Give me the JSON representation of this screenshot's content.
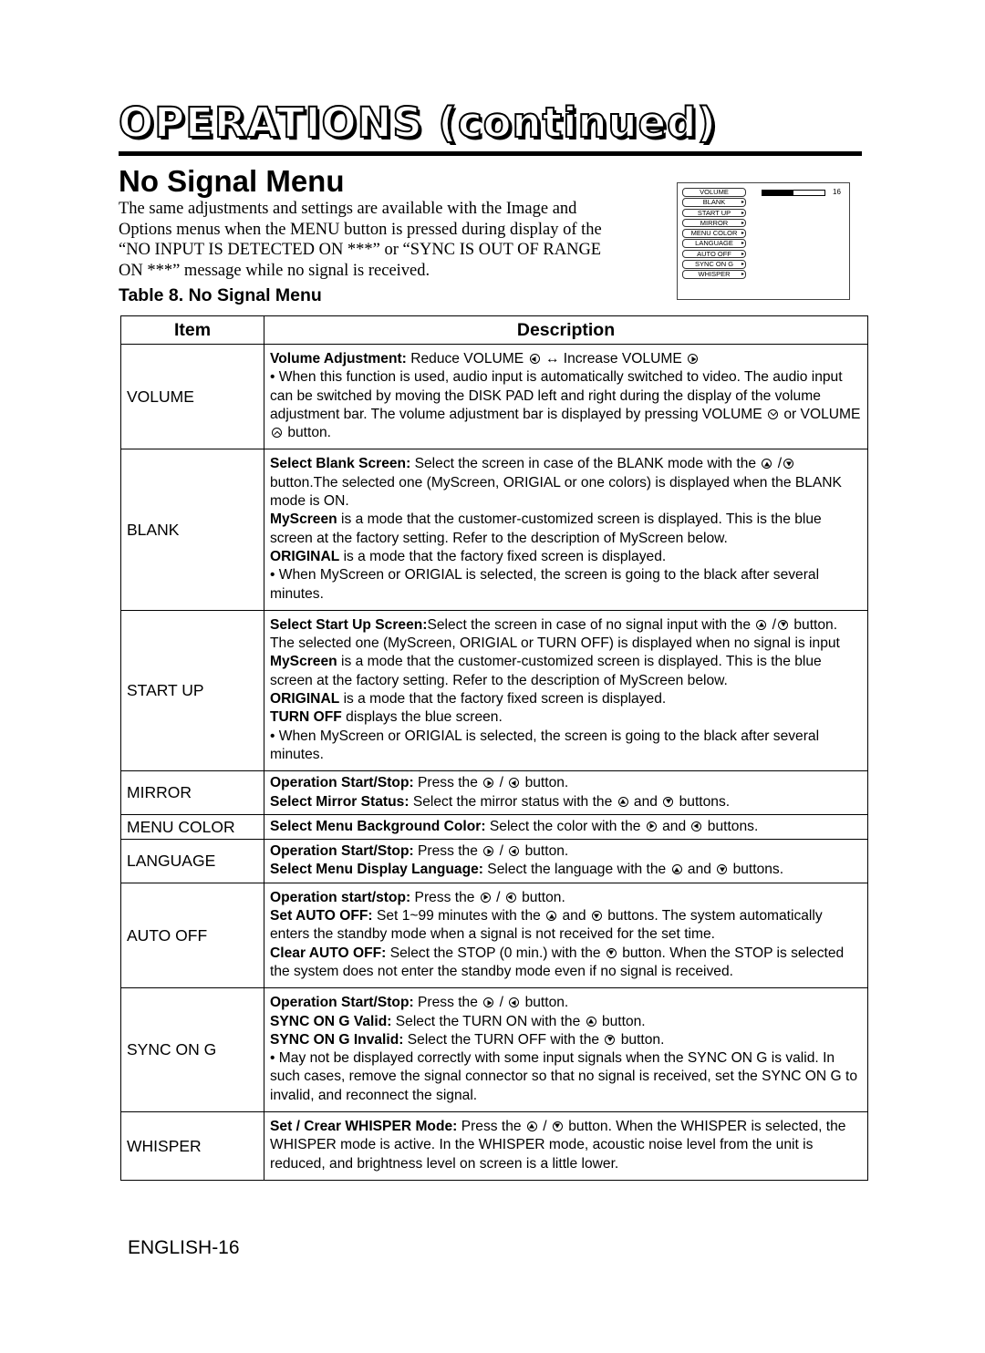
{
  "header": {
    "title": "OPERATIONS (continued)",
    "section_heading": "No Signal Menu"
  },
  "intro": {
    "lines": [
      "The same adjustments and settings are available with the Image and",
      "Options menus when the MENU button is pressed during display of the",
      "“NO INPUT IS DETECTED ON ***” or “SYNC IS OUT OF RANGE",
      "ON ***” message while no signal is received."
    ]
  },
  "menu_preview": {
    "items": [
      {
        "label": "VOLUME",
        "has_arrow": false
      },
      {
        "label": "BLANK",
        "has_arrow": true
      },
      {
        "label": "START UP",
        "has_arrow": true
      },
      {
        "label": "MIRROR",
        "has_arrow": true
      },
      {
        "label": "MENU COLOR",
        "has_arrow": true
      },
      {
        "label": "LANGUAGE",
        "has_arrow": true
      },
      {
        "label": "AUTO OFF",
        "has_arrow": true
      },
      {
        "label": "SYNC ON G",
        "has_arrow": true
      },
      {
        "label": "WHISPER",
        "has_arrow": true
      }
    ],
    "arrow_glyph": "▸",
    "volume_value": "16",
    "volume_fill_fraction": 0.5
  },
  "table": {
    "caption": "Table 8. No Signal Menu",
    "headers": {
      "item": "Item",
      "description": "Description"
    },
    "rows": [
      {
        "item": "VOLUME",
        "lines": [
          [
            {
              "b": "Volume Adjustment:"
            },
            {
              "t": " Reduce VOLUME "
            },
            {
              "icon": "left"
            },
            {
              "t": " ↔ Increase VOLUME "
            },
            {
              "icon": "right"
            }
          ],
          [
            {
              "t": "• When this function is used, audio input is automatically switched to video. The audio input can be switched by moving the DISK PAD left and right during the display of the volume adjustment bar. The volume adjustment bar is displayed by pressing VOLUME "
            },
            {
              "icon": "vdown"
            },
            {
              "t": " or VOLUME "
            },
            {
              "icon": "vup"
            },
            {
              "t": " button."
            }
          ]
        ]
      },
      {
        "item": "BLANK",
        "lines": [
          [
            {
              "b": "Select Blank Screen:"
            },
            {
              "t": " Select the screen in case of the BLANK mode with the "
            },
            {
              "icon": "up"
            },
            {
              "t": " /"
            },
            {
              "icon": "down"
            },
            {
              "t": " button.The selected one (MyScreen, ORIGIAL or one colors) is displayed when the BLANK mode is ON."
            }
          ],
          [
            {
              "b": "MyScreen"
            },
            {
              "t": " is a mode that the customer-customized screen is displayed. This is the blue screen at the factory setting. Refer to the description of MyScreen below."
            }
          ],
          [
            {
              "b": "ORIGINAL"
            },
            {
              "t": " is a mode that the factory fixed screen is displayed."
            }
          ],
          [
            {
              "t": "• When MyScreen or ORIGIAL is selected, the screen is going to the black after several minutes."
            }
          ]
        ]
      },
      {
        "item": "START UP",
        "lines": [
          [
            {
              "b": "Select Start Up Screen:"
            },
            {
              "t": "Select the screen in case of no signal input with the "
            },
            {
              "icon": "up"
            },
            {
              "t": " /"
            },
            {
              "icon": "down"
            },
            {
              "t": " button. The selected one (MyScreen, ORIGIAL or TURN OFF) is displayed when no signal is input"
            }
          ],
          [
            {
              "b": "MyScreen"
            },
            {
              "t": " is a mode that the customer-customized screen is displayed. This is the blue screen at the factory setting. Refer to the description of MyScreen below."
            }
          ],
          [
            {
              "b": "ORIGINAL"
            },
            {
              "t": " is a mode that the factory fixed screen is displayed."
            }
          ],
          [
            {
              "b": "TURN OFF"
            },
            {
              "t": " displays the blue screen."
            }
          ],
          [
            {
              "t": "• When MyScreen or ORIGIAL is selected, the screen is going to the black after several minutes."
            }
          ]
        ]
      },
      {
        "item": "MIRROR",
        "compact": true,
        "lines": [
          [
            {
              "b": "Operation Start/Stop:"
            },
            {
              "t": " Press the "
            },
            {
              "icon": "right"
            },
            {
              "t": " / "
            },
            {
              "icon": "left"
            },
            {
              "t": " button."
            }
          ],
          [
            {
              "b": "Select Mirror Status:"
            },
            {
              "t": " Select the mirror status with the "
            },
            {
              "icon": "up"
            },
            {
              "t": " and "
            },
            {
              "icon": "down"
            },
            {
              "t": " buttons."
            }
          ]
        ]
      },
      {
        "item": "MENU COLOR",
        "compact": true,
        "lines": [
          [
            {
              "b": "Select Menu Background Color:"
            },
            {
              "t": " Select the color with the "
            },
            {
              "icon": "right"
            },
            {
              "t": " and "
            },
            {
              "icon": "left"
            },
            {
              "t": " buttons."
            }
          ]
        ]
      },
      {
        "item": "LANGUAGE",
        "compact": true,
        "lines": [
          [
            {
              "b": "Operation Start/Stop:"
            },
            {
              "t": " Press the "
            },
            {
              "icon": "right"
            },
            {
              "t": " / "
            },
            {
              "icon": "left"
            },
            {
              "t": " button."
            }
          ],
          [
            {
              "b": "Select Menu Display Language:"
            },
            {
              "t": " Select the language with the "
            },
            {
              "icon": "up"
            },
            {
              "t": " and "
            },
            {
              "icon": "down"
            },
            {
              "t": " buttons."
            }
          ]
        ]
      },
      {
        "item": "AUTO OFF",
        "lines": [
          [
            {
              "b": "Operation start/stop:"
            },
            {
              "t": " Press the "
            },
            {
              "icon": "right"
            },
            {
              "t": " / "
            },
            {
              "icon": "left"
            },
            {
              "t": " button."
            }
          ],
          [
            {
              "b": "Set AUTO OFF:"
            },
            {
              "t": " Set 1~99 minutes with the "
            },
            {
              "icon": "up"
            },
            {
              "t": " and "
            },
            {
              "icon": "down"
            },
            {
              "t": " buttons. The system automatically enters the standby mode when a signal is not received for the set time."
            }
          ],
          [
            {
              "b": "Clear AUTO OFF:"
            },
            {
              "t": " Select the STOP (0 min.) with the "
            },
            {
              "icon": "down"
            },
            {
              "t": " button. When the STOP is selected the system does not enter the standby mode even if no signal is received."
            }
          ]
        ]
      },
      {
        "item": "SYNC ON G",
        "lines": [
          [
            {
              "b": "Operation Start/Stop:"
            },
            {
              "t": " Press the "
            },
            {
              "icon": "right"
            },
            {
              "t": " / "
            },
            {
              "icon": "left"
            },
            {
              "t": " button."
            }
          ],
          [
            {
              "b": "SYNC ON G Valid:"
            },
            {
              "t": " Select the TURN ON with the "
            },
            {
              "icon": "up"
            },
            {
              "t": " button."
            }
          ],
          [
            {
              "b": "SYNC ON G Invalid:"
            },
            {
              "t": " Select the TURN OFF with the "
            },
            {
              "icon": "down"
            },
            {
              "t": " button."
            }
          ],
          [
            {
              "t": "• May not be displayed correctly with some input signals when the SYNC ON G is valid. In such cases, remove the signal connector so that no signal is received, set the SYNC ON G to invalid, and reconnect the signal."
            }
          ]
        ]
      },
      {
        "item": "WHISPER",
        "lines": [
          [
            {
              "b": "Set / Crear WHISPER Mode:"
            },
            {
              "t": " Press the "
            },
            {
              "icon": "up"
            },
            {
              "t": " / "
            },
            {
              "icon": "down"
            },
            {
              "t": " button.  When the WHISPER is selected, the WHISPER mode is active. In the WHISPER mode, acoustic noise level from the unit is reduced, and brightness level on screen is a little lower."
            }
          ]
        ]
      }
    ]
  },
  "footer": {
    "page_label": "ENGLISH-16"
  },
  "icons": {
    "left": "left-arrow-button-icon",
    "right": "right-arrow-button-icon",
    "up": "up-arrow-button-icon",
    "down": "down-arrow-button-icon",
    "vdown": "volume-down-button-icon",
    "vup": "volume-up-button-icon"
  }
}
